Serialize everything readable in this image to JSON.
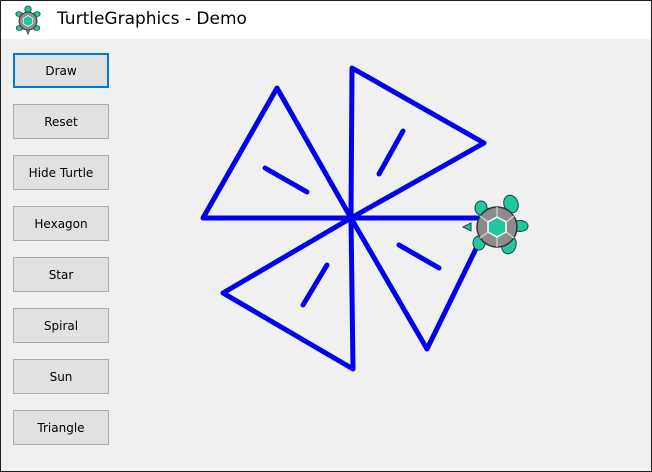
{
  "window": {
    "title": "TurtleGraphics - Demo"
  },
  "buttons": [
    {
      "label": "Draw",
      "focused": true
    },
    {
      "label": "Reset"
    },
    {
      "label": "Hide Turtle"
    },
    {
      "label": "Hexagon"
    },
    {
      "label": "Star"
    },
    {
      "label": "Spiral"
    },
    {
      "label": "Sun"
    },
    {
      "label": "Triangle"
    }
  ],
  "drawing": {
    "pen_color": "#0000ee",
    "turtle_shell_color": "#8c8c8c",
    "turtle_body_color": "#22c7a0"
  }
}
